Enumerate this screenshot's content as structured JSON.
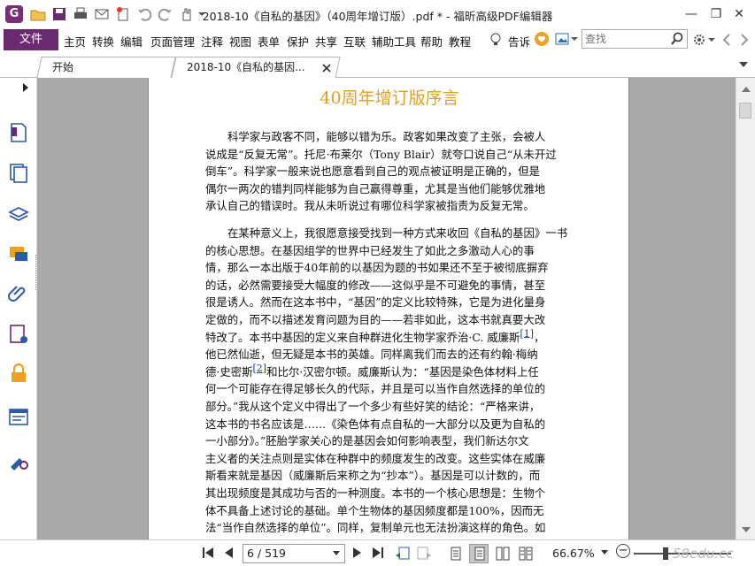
{
  "titlebar": {
    "title": "2018-10《自私的基因》（40周年增订版）.pdf * - 福昕高级PDF编辑器",
    "logo_letter": "G",
    "minimize": "—",
    "restore": "❐",
    "close": "✕"
  },
  "menu": {
    "file": "文件",
    "items": [
      "主页",
      "转换",
      "编辑",
      "页面管理",
      "注释",
      "视图",
      "表单",
      "保护",
      "共享",
      "互联",
      "辅助工具",
      "帮助",
      "教程"
    ],
    "tell_me": "告诉",
    "search_placeholder": "查找"
  },
  "tabs": [
    {
      "label": "开始"
    },
    {
      "label": "2018-10《自私的基因..."
    }
  ],
  "document": {
    "title": "40周年增订版序言",
    "paragraph1": [
      "科学家与政客不同，能够以错为乐。政客如果改变了主张，会被人",
      "说成是“反复无常”。托尼·布莱尔（Tony Blair）就夸口说自己“从未开过",
      "倒车”。科学家一般来说也愿意看到自己的观点被证明是正确的，但是",
      "偶尔一两次的错判同样能够为自己赢得尊重，尤其是当他们能够优雅地",
      "承认自己的错误时。我从未听说过有哪位科学家被指责为反复无常。"
    ],
    "paragraph2_a": [
      "在某种意义上，我很愿意接受找到一种方式来收回《自私的基因》一书",
      "的核心思想。在基因组学的世界中已经发生了如此之多激动人心的事",
      "情，那么一本出版于40年前的以基因为题的书如果还不至于被彻底摒弃",
      "的话，必然需要接受大幅度的修改——这似乎是不可避免的事情，甚至",
      "很是诱人。然而在这本书中，“基因”的定义比较特殊，它是为进化量身",
      "定做的，而不以描述发育问题为目的——若非如此，这本书就真要大改"
    ],
    "line_fn1_pre": "特改了。本书中基因的定义来自种群进化生物学家乔治·C. 威廉斯",
    "fn1": "[1]",
    "line_fn1_post": "，",
    "line_after_fn1": "他已然仙逝，但无疑是本书的英雄。同样离我们而去的还有约翰·梅纳",
    "line_fn2_pre": "德·史密斯",
    "fn2": "[2]",
    "line_fn2_post": "和比尔·汉密尔顿。威廉斯认为：“基因是染色体材料上任",
    "paragraph2_b": [
      "何一个可能存在得足够长久的代际，并且是可以当作自然选择的单位的",
      "部分。”我从这个定义中得出了一个多少有些好笑的结论：“严格来讲，",
      "这本书的书名应该是……《染色体有点自私的一大部分以及更为自私的",
      "一小部分》。”胚胎学家关心的是基因会如何影响表型，我们新达尔文",
      "主义者的关注点则是实体在种群中的频度发生的改变。这些实体在威廉",
      "斯看来就是基因（威廉斯后来称之为“抄本”）。基因是可以计数的，而",
      "其出现频度是其成功与否的一种测度。本书的一个核心思想是：生物个",
      "体不具备上述讨论的基础。单个生物体的基因频度都是100%，因而无",
      "法“当作自然选择的单位”。同样，复制单元也无法扮演这样的角色。如"
    ]
  },
  "statusbar": {
    "page_value": "6 / 519",
    "zoom": "66.67%",
    "zoom_minus": "−",
    "watermark": "58edu.cc",
    "zoom_level_fraction": 0.33
  },
  "colors": {
    "file_button": "#6a2a6e",
    "title_accent": "#e0a020",
    "doc_background": "#a9a9a9"
  }
}
